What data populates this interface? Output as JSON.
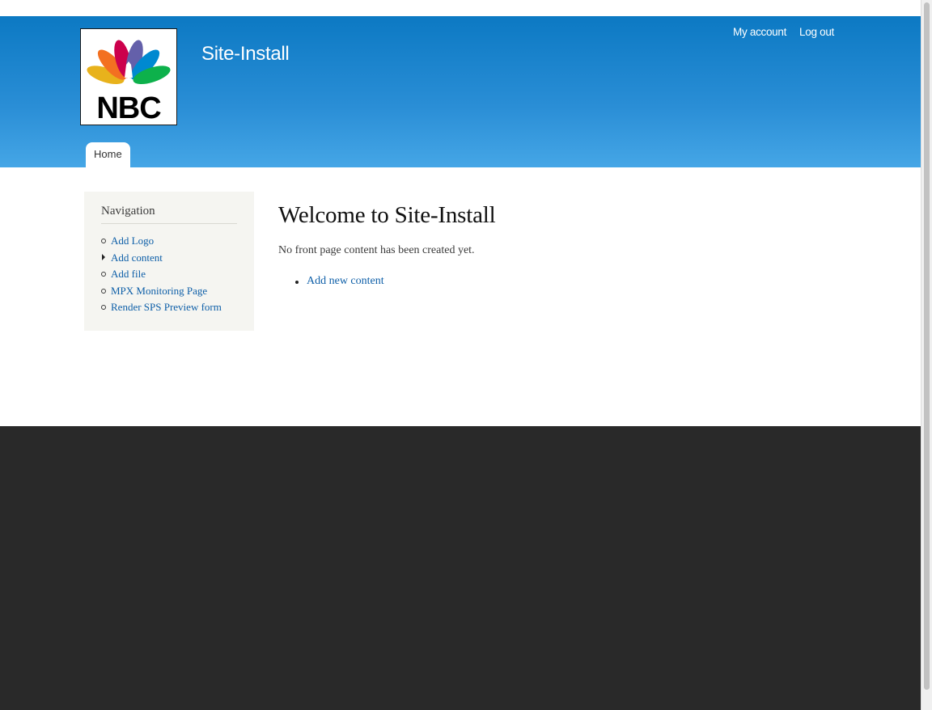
{
  "header": {
    "logo_text": "NBC",
    "site_name": "Site-Install",
    "secondary_menu": [
      {
        "label": "My account"
      },
      {
        "label": "Log out"
      }
    ],
    "main_menu": [
      {
        "label": "Home",
        "active": true
      }
    ]
  },
  "sidebar": {
    "title": "Navigation",
    "items": [
      {
        "label": "Add Logo",
        "bullet": "circle"
      },
      {
        "label": "Add content",
        "bullet": "arrow"
      },
      {
        "label": "Add file",
        "bullet": "circle"
      },
      {
        "label": "MPX Monitoring Page",
        "bullet": "circle"
      },
      {
        "label": "Render SPS Preview form",
        "bullet": "circle"
      }
    ]
  },
  "main": {
    "title": "Welcome to Site-Install",
    "message": "No front page content has been created yet.",
    "links": [
      {
        "label": "Add new content"
      }
    ]
  },
  "colors": {
    "header_top": "#0c79c3",
    "header_bottom": "#45a6e6",
    "link": "#0e5fa8",
    "sidebar_bg": "#f5f5f1",
    "footer_bg": "#292929"
  }
}
